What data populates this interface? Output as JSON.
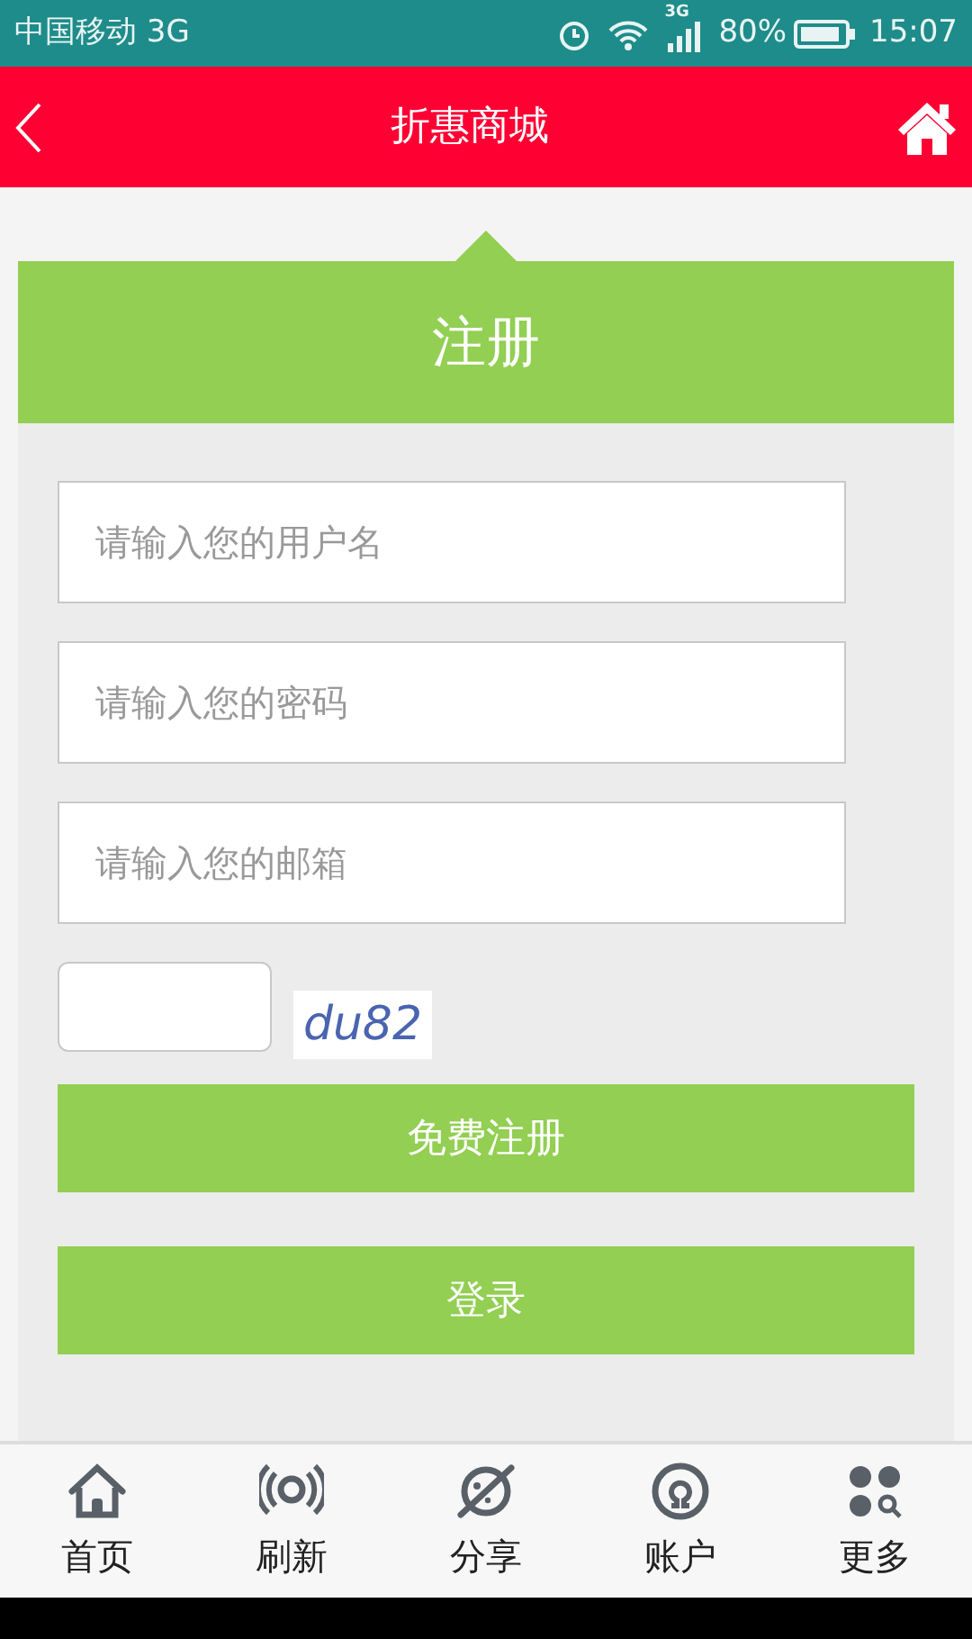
{
  "status_bar": {
    "carrier": "中国移动 3G",
    "network": "3G",
    "battery": "80%",
    "time": "15:07"
  },
  "header": {
    "title": "折惠商城"
  },
  "form": {
    "title": "注册",
    "fields": [
      {
        "placeholder": "请输入您的用户名"
      },
      {
        "placeholder": "请输入您的密码"
      },
      {
        "placeholder": "请输入您的邮箱"
      }
    ],
    "captcha": "du82",
    "buttons": [
      "免费注册",
      "登录"
    ]
  },
  "bottom_nav": [
    {
      "label": "首页",
      "kind": "home"
    },
    {
      "label": "刷新",
      "kind": "refresh"
    },
    {
      "label": "分享",
      "kind": "share"
    },
    {
      "label": "账户",
      "kind": "account"
    },
    {
      "label": "更多",
      "kind": "more"
    }
  ]
}
